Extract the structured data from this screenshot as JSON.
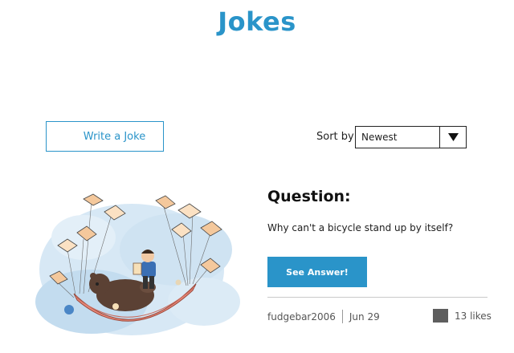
{
  "header": {
    "title": "Jokes"
  },
  "toolbar": {
    "write_label": "Write a Joke",
    "sort_label": "Sort by",
    "sort_value": "Newest",
    "sort_icon": "triangle-down-icon"
  },
  "joke": {
    "heading": "Question:",
    "question": "Why can't a bicycle stand up by itself?",
    "answer_button": "See Answer!",
    "author": "fudgebar2006",
    "date": "Jun 29",
    "likes": "13 likes",
    "like_icon": "like-icon"
  },
  "colors": {
    "accent": "#2a94c9",
    "like_icon": "#5e5e5e"
  }
}
